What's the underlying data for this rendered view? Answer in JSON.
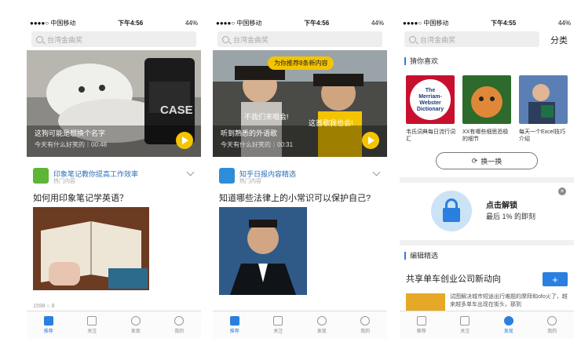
{
  "status": {
    "carrier": "●●●●○ 中国移动",
    "battery": "44%",
    "time1": "下午4:56",
    "time2": "下午4:56",
    "time3": "下午4:55"
  },
  "search": {
    "placeholder": "台湾金曲奖"
  },
  "tabs": [
    "推荐",
    "关注",
    "发现",
    "我的"
  ],
  "phone1": {
    "video_title": "这狗可能是想换个名字",
    "video_meta": "今天有什么好笑的｜00:48",
    "video_label": "CASE",
    "feed_name": "印象笔记教你提高工作效率",
    "feed_sub": "热门内容",
    "question": "如何用印象笔记学英语？",
    "engage": "1598   ○ 8"
  },
  "phone2": {
    "banner": "为你推荐8条新内容",
    "bubble1": "不我们来唱会!",
    "bubble2": "这首歌我也会!",
    "video_title": "听到熟悉的外语歌",
    "video_meta": "今天有什么好笑的｜00:31",
    "feed_name": "知乎日报内容精选",
    "feed_sub": "热门内容",
    "question": "知道哪些法律上的小常识可以保护自己?"
  },
  "phone3": {
    "category": "分类",
    "sec1": "猜你喜欢",
    "book1_title": "The Merriam-Webster Dictionary",
    "items": [
      {
        "text": "韦氏词典每日流行词汇"
      },
      {
        "text": "XX有哪些细思恐极的细节"
      },
      {
        "text": "每天一个Excel技巧介绍"
      }
    ],
    "swap": "换一换",
    "unlock_title": "点击解锁",
    "unlock_sub": "最后 1% 的即刻",
    "sec2": "编辑精选",
    "topic": "共享单车创业公司新动向",
    "topic_desc": "试图解决城市短途出行难题的摩拜和ofo火了，越来越多单车出现在街头，那到",
    "add": "+"
  }
}
